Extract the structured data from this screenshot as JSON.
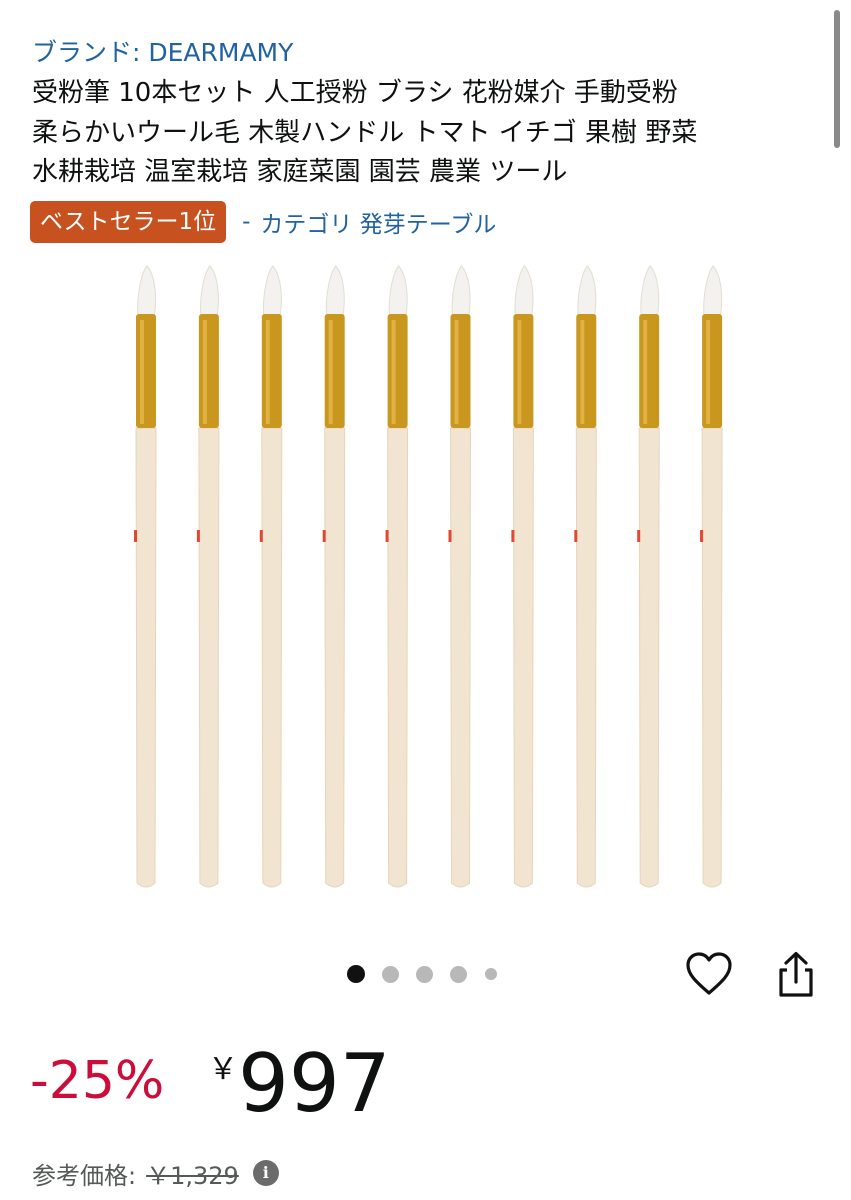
{
  "product": {
    "brand_link": "ブランド: DEARMAMY",
    "title_lines": [
      "受粉筆 10本セット 人工授粉 ブラシ 花粉媒介 手動受粉",
      "柔らかいウール毛 木製ハンドル トマト イチゴ 果樹 野菜",
      "水耕栽培 温室栽培 家庭菜園 園芸 農業 ツール"
    ],
    "bestseller_badge": "ベストセラー1位",
    "category_separator": "-",
    "category_link": "カテゴリ 発芽テーブル"
  },
  "gallery": {
    "image_description_icon": "pollination-brushes-image",
    "brush_count": 10,
    "dot_count": 5,
    "active_dot": 1,
    "colors": {
      "bristles": "#f4f2ee",
      "ferrule": "#c9961e",
      "handle": "#f1e4d0",
      "mark": "#e2472f",
      "active_dot": "#111111",
      "inactive_dot": "#b8b8b8"
    }
  },
  "actions": {
    "wishlist_icon": "heart-icon",
    "share_icon": "share-icon"
  },
  "pricing": {
    "discount": "-25%",
    "currency_symbol": "￥",
    "price": "997",
    "reference_label": "参考価格:",
    "reference_price": "￥1,329",
    "info_icon_glyph": "i",
    "discount_color": "#cc0c39"
  }
}
